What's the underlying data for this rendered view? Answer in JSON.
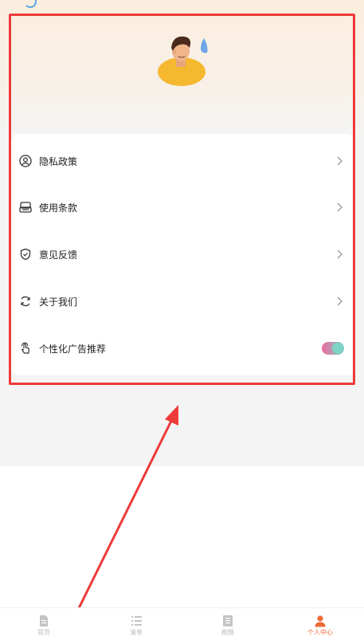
{
  "menu": {
    "items": [
      {
        "label": "隐私政策",
        "icon": "user-circle-icon"
      },
      {
        "label": "使用条款",
        "icon": "document-stack-icon"
      },
      {
        "label": "意见反馈",
        "icon": "shield-check-icon"
      },
      {
        "label": "关于我们",
        "icon": "refresh-icon"
      },
      {
        "label": "个性化广告推荐",
        "icon": "touch-finger-icon"
      }
    ],
    "ad_toggle_on": true
  },
  "tabbar": {
    "tabs": [
      {
        "label": "首页",
        "icon": "document-icon",
        "active": false
      },
      {
        "label": "清单",
        "icon": "list-icon",
        "active": false
      },
      {
        "label": "刷题",
        "icon": "book-icon",
        "active": false
      },
      {
        "label": "个人中心",
        "icon": "person-icon",
        "active": true
      }
    ]
  },
  "colors": {
    "accent": "#ee6a3a",
    "annotation": "#ee3a3a",
    "toggle_start": "#f06aa0",
    "toggle_end": "#78cfc0"
  }
}
